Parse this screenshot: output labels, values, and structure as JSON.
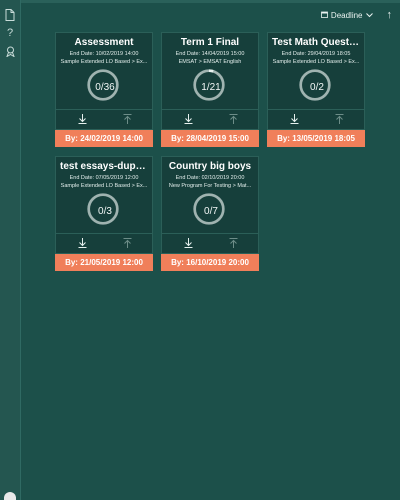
{
  "sort": {
    "label": "Deadline",
    "icon": "calendar-icon"
  },
  "sidebar": {
    "icons": [
      "document-icon",
      "help-icon",
      "badge-icon",
      "avatar"
    ]
  },
  "colors": {
    "background": "#1c504a",
    "card": "#163f3b",
    "deadline_bar": "#f07f5a",
    "progress_ring": "#b8c8c5"
  },
  "cards": [
    {
      "title": "Assessment",
      "end_date": "End Date: 10/02/2019 14:00",
      "path": "Sample Extended LO Based > Ex...",
      "progress": "0/36",
      "deadline": "By: 24/02/2019 14:00"
    },
    {
      "title": "Term 1 Final",
      "end_date": "End Date: 14/04/2019 15:00",
      "path": "EMSAT > EMSAT English",
      "progress": "1/21",
      "deadline": "By: 28/04/2019 15:00"
    },
    {
      "title": "Test Math Questio...",
      "end_date": "End Date: 29/04/2019 18:05",
      "path": "Sample Extended LO Based > Ex...",
      "progress": "0/2",
      "deadline": "By: 13/05/2019 18:05"
    },
    {
      "title": "test essays-duplic...",
      "end_date": "End Date: 07/05/2019 12:00",
      "path": "Sample Extended LO Based > Ex...",
      "progress": "0/3",
      "deadline": "By: 21/05/2019 12:00"
    },
    {
      "title": "Country big boys",
      "end_date": "End Date: 02/10/2019 20:00",
      "path": "New Program For Testing > Mat...",
      "progress": "0/7",
      "deadline": "By: 16/10/2019 20:00"
    }
  ]
}
